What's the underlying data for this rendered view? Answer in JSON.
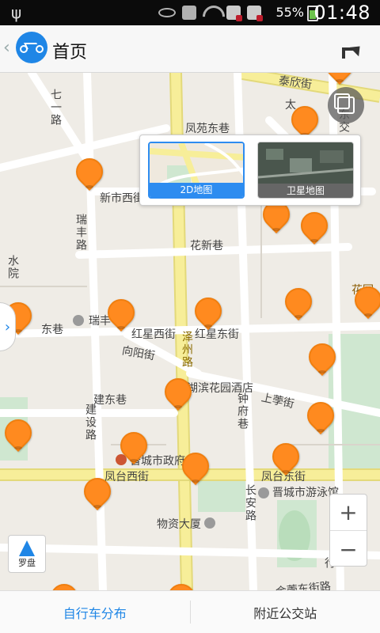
{
  "status_bar": {
    "battery_percent": "55%",
    "time": "01:48"
  },
  "header": {
    "title": "首页"
  },
  "map_layers": {
    "options": [
      {
        "label": "2D地图",
        "selected": true
      },
      {
        "label": "卫星地图",
        "selected": false
      }
    ]
  },
  "map": {
    "labels": {
      "qiyilu": "七一路",
      "tai": "泰欣街",
      "taiyang": "太",
      "dongjiao": "东交",
      "fengyuan": "凤苑东巷",
      "xinshi": "新市西街",
      "ruifeng": "瑞丰路",
      "huaxin": "花新巷",
      "shuiyuan": "水院",
      "huayuan": "花园",
      "dongxiang": "东巷",
      "ruifeng2": "瑞丰",
      "hongxingxi": "红星西街",
      "hongxingdong": "红星东街",
      "zezhou": "泽州路",
      "xiangyang": "向阳街",
      "hubin": "湖滨花园酒店",
      "jiandong": "建东巷",
      "zhongfu": "钟府巷",
      "shangyi": "上荸街",
      "jianshe": "建设路",
      "jincheng_gov": "晋城市政府",
      "fengtaixi": "凤台西街",
      "fengtaidong": "凤台东街",
      "changan": "长安路",
      "youyong": "晋城市游泳馆",
      "wuzi": "物资大厦",
      "jinjiao": "金荸东街路",
      "xing": "行"
    }
  },
  "controls": {
    "compass_label": "罗盘",
    "zoom_in": "+",
    "zoom_out": "−",
    "left_tab": "›"
  },
  "bottom_nav": {
    "tabs": [
      {
        "label": "自行车分布",
        "active": true
      },
      {
        "label": "附近公交站",
        "active": false
      }
    ]
  },
  "colors": {
    "accent": "#1f86e6",
    "pin": "#ff8a1f",
    "major_road": "#f2e58a",
    "park": "#cfe7d0"
  }
}
